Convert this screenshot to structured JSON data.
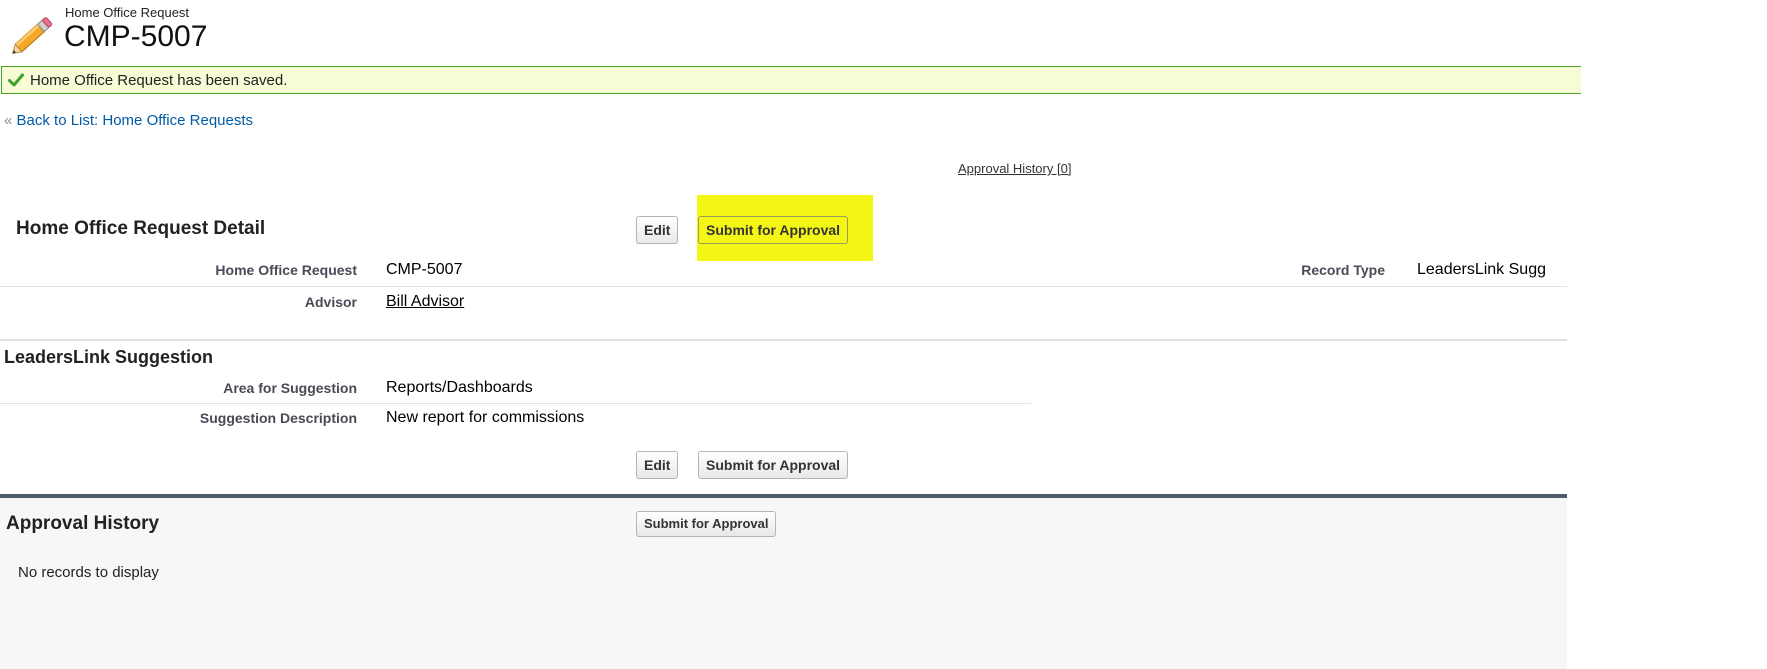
{
  "header": {
    "object_type": "Home Office Request",
    "record_name": "CMP-5007",
    "icon": "pencil-icon"
  },
  "banner": {
    "message": "Home Office Request has been saved.",
    "icon": "checkmark-icon"
  },
  "nav": {
    "back_prefix": "«",
    "back_link": "Back to List: Home Office Requests",
    "approval_history_link": "Approval History [0]"
  },
  "detail": {
    "title": "Home Office Request Detail",
    "buttons": {
      "edit": "Edit",
      "submit": "Submit for Approval"
    },
    "fields": {
      "home_office_request": {
        "label": "Home Office Request",
        "value": "CMP-5007"
      },
      "record_type": {
        "label": "Record Type",
        "value": "LeadersLink Sugg"
      },
      "advisor": {
        "label": "Advisor",
        "value": "Bill Advisor"
      }
    }
  },
  "suggestion": {
    "title": "LeadersLink Suggestion",
    "fields": {
      "area": {
        "label": "Area for Suggestion",
        "value": "Reports/Dashboards"
      },
      "description": {
        "label": "Suggestion Description",
        "value": "New report for commissions"
      }
    }
  },
  "bottom_buttons": {
    "edit": "Edit",
    "submit": "Submit for Approval"
  },
  "approval_history": {
    "title": "Approval History",
    "submit_button": "Submit for Approval",
    "empty_text": "No records to display"
  },
  "colors": {
    "banner_bg": "#f7fbd6",
    "banner_border": "#4aa829",
    "highlight": "#f4f716",
    "link": "#015ba7"
  }
}
